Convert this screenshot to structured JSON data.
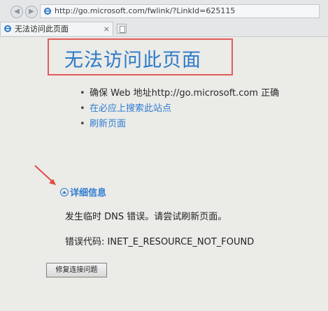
{
  "browser": {
    "address_url": "http://go.microsoft.com/fwlink/?LinkId=625115",
    "tab_title": "无法访问此页面",
    "tab_close": "×"
  },
  "page": {
    "title": "无法访问此页面",
    "tips": [
      {
        "text": "确保 Web 地址http://go.microsoft.com 正确",
        "link": false
      },
      {
        "text": "在必应上搜索此站点",
        "link": true
      },
      {
        "text": "刷新页面",
        "link": true
      }
    ],
    "details_label": "详细信息",
    "error_message": "发生临时 DNS 错误。请尝试刷新页面。",
    "error_code": "错误代码: INET_E_RESOURCE_NOT_FOUND",
    "repair_button": "修复连接问题"
  }
}
